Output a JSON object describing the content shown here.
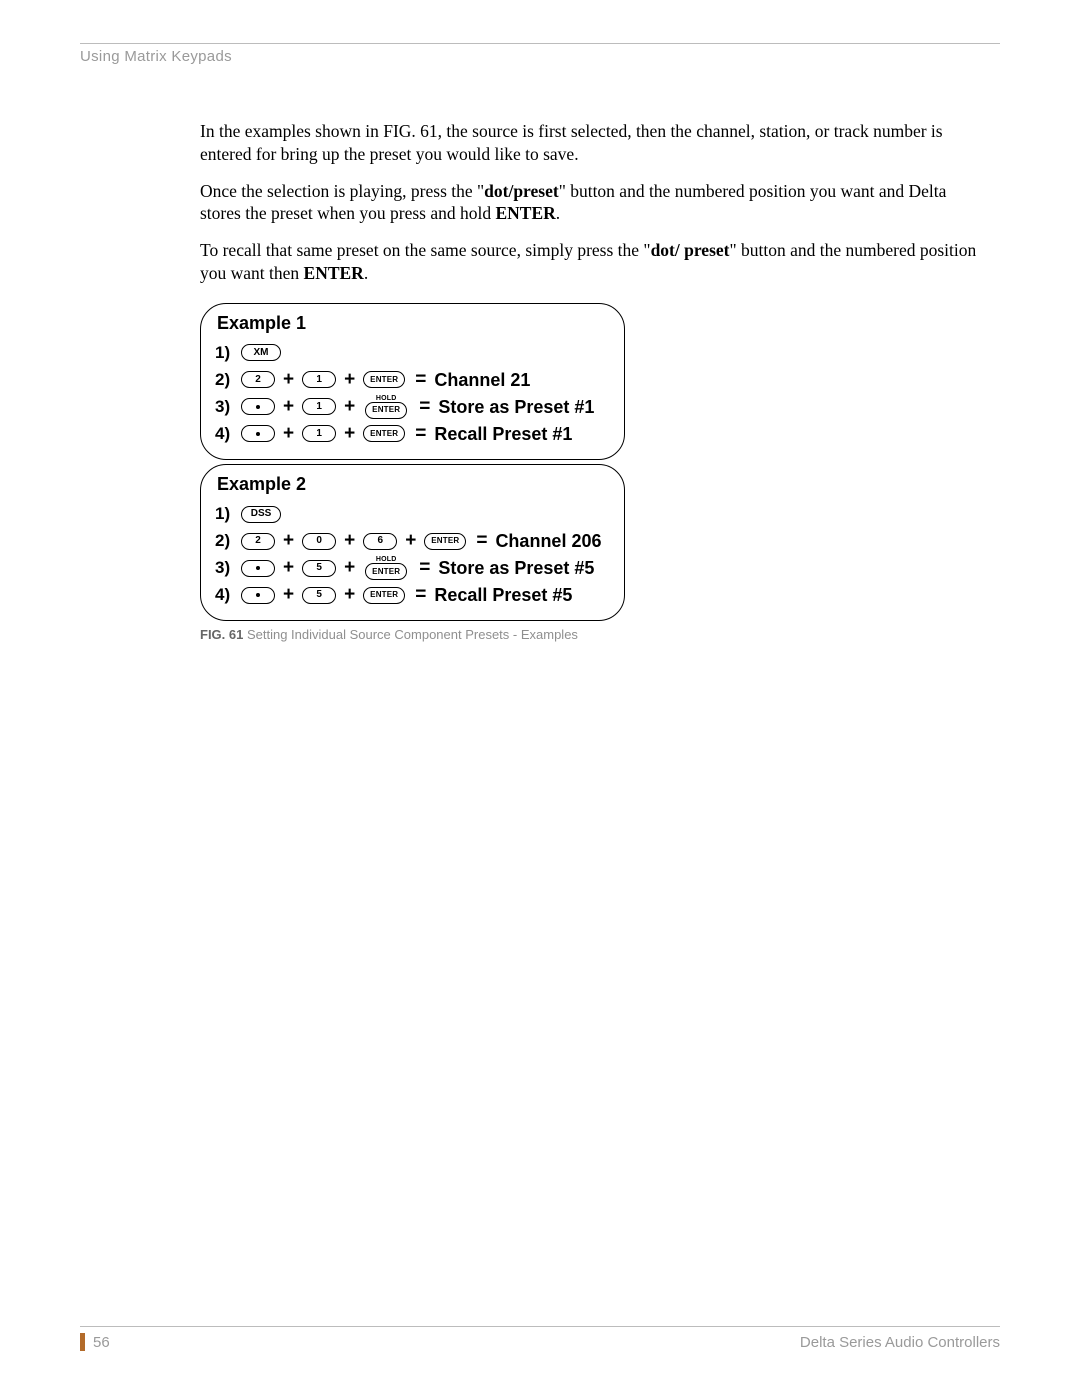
{
  "header": {
    "section": "Using Matrix Keypads"
  },
  "body": {
    "p1_a": "In the examples shown in FIG. 61, the source is first selected, then the channel, station, or track number is entered for bring up the preset you would like to save.",
    "p2_a": "Once the selection is playing, press the \"",
    "p2_b": "dot/preset",
    "p2_c": "\" button and the numbered position you want and Delta stores the preset when you press and hold ",
    "p2_d": "ENTER",
    "p2_e": ".",
    "p3_a": "To recall that same preset on the same source, simply press the \"",
    "p3_b": "dot/ preset",
    "p3_c": "\" button and the numbered position you want then ",
    "p3_d": "ENTER",
    "p3_e": "."
  },
  "figure": {
    "ex1": {
      "title": "Example 1",
      "s1_num": "1)",
      "s1_key": "XM",
      "s2_num": "2)",
      "s2_k1": "2",
      "s2_k2": "1",
      "s2_enter": "ENTER",
      "s2_result": "Channel 21",
      "s3_num": "3)",
      "s3_k2": "1",
      "s3_hold": "HOLD",
      "s3_enter": "ENTER",
      "s3_result": "Store as Preset #1",
      "s4_num": "4)",
      "s4_k2": "1",
      "s4_enter": "ENTER",
      "s4_result": "Recall Preset #1"
    },
    "ex2": {
      "title": "Example 2",
      "s1_num": "1)",
      "s1_key": "DSS",
      "s2_num": "2)",
      "s2_k1": "2",
      "s2_k2": "0",
      "s2_k3": "6",
      "s2_enter": "ENTER",
      "s2_result": "Channel 206",
      "s3_num": "3)",
      "s3_k2": "5",
      "s3_hold": "HOLD",
      "s3_enter": "ENTER",
      "s3_result": "Store as Preset #5",
      "s4_num": "4)",
      "s4_k2": "5",
      "s4_enter": "ENTER",
      "s4_result": "Recall Preset #5"
    },
    "caption_num": "FIG. 61",
    "caption_text": "  Setting Individual Source Component Presets - Examples"
  },
  "footer": {
    "page": "56",
    "doc": "Delta Series Audio Controllers"
  },
  "sym": {
    "plus": "+",
    "equals": "="
  }
}
